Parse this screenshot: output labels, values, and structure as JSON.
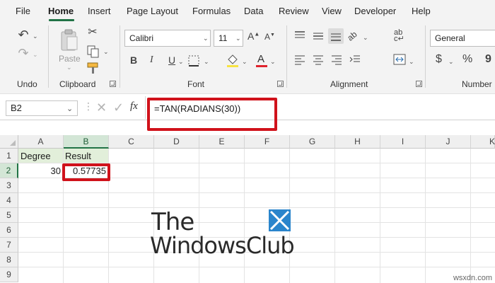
{
  "menu": {
    "items": [
      "File",
      "Home",
      "Insert",
      "Page Layout",
      "Formulas",
      "Data",
      "Review",
      "View",
      "Developer",
      "Help"
    ],
    "active": "Home"
  },
  "ribbon": {
    "undo_group_label": "Undo",
    "clipboard": {
      "label": "Clipboard",
      "paste_label": "Paste"
    },
    "font": {
      "label": "Font",
      "name": "Calibri",
      "size": "11",
      "bold": "B",
      "italic": "I",
      "underline": "U",
      "font_color_letter": "A"
    },
    "alignment": {
      "label": "Alignment"
    },
    "number": {
      "label": "Number",
      "format": "General",
      "currency": "$",
      "percent": "%",
      "comma": "9"
    }
  },
  "formula_bar": {
    "name_box": "B2",
    "fx_label": "fx",
    "formula": "=TAN(RADIANS(30))"
  },
  "sheet": {
    "columns": [
      "A",
      "B",
      "C",
      "D",
      "E",
      "F",
      "G",
      "H",
      "I",
      "J",
      "K"
    ],
    "selected_column": "B",
    "rows": [
      "1",
      "2",
      "3",
      "4",
      "5",
      "6",
      "7",
      "8",
      "9"
    ],
    "selected_row": "2",
    "cells": {
      "A1": "Degree",
      "B1": "Result",
      "A2": "30",
      "B2": "0.57735"
    }
  },
  "logo": {
    "line1": "The",
    "line2": "WindowsClub"
  },
  "watermark": "wsxdn.com",
  "colors": {
    "accent": "#217346",
    "highlight_red": "#d0121b",
    "header_fill": "#e2efda",
    "logo_blue": "#2a85cc"
  }
}
